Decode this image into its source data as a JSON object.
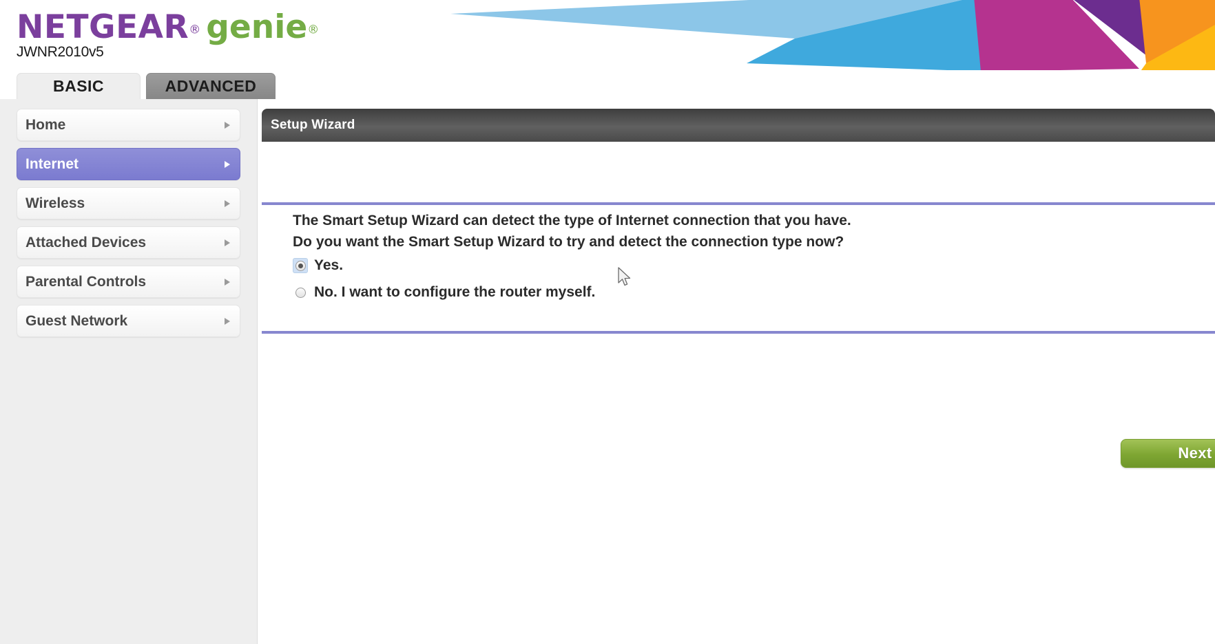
{
  "header": {
    "brand_netgear": "NETGEAR",
    "brand_registered": "®",
    "brand_genie": "genie",
    "brand_genie_registered": "®",
    "model": "JWNR2010v5",
    "brand_purple": "#7b3f9d",
    "brand_green": "#74ac45",
    "art_colors": [
      "#8cc6e8",
      "#3fa9dd",
      "#b5338f",
      "#6c2d8f",
      "#f7941e",
      "#fdb813"
    ]
  },
  "tabs": [
    {
      "label": "BASIC",
      "active": true
    },
    {
      "label": "ADVANCED",
      "active": false
    }
  ],
  "sidebar": {
    "items": [
      {
        "label": "Home",
        "selected": false
      },
      {
        "label": "Internet",
        "selected": true
      },
      {
        "label": "Wireless",
        "selected": false
      },
      {
        "label": "Attached Devices",
        "selected": false
      },
      {
        "label": "Parental Controls",
        "selected": false
      },
      {
        "label": "Guest Network",
        "selected": false
      }
    ],
    "selected_color": "#7b7bd0"
  },
  "content": {
    "panel_title": "Setup Wizard",
    "rule_color": "#8787cf",
    "body_line_1": "The Smart Setup Wizard can detect the type of Internet connection that you have.",
    "body_line_2": "Do you want the Smart Setup Wizard to try and detect the connection type now?",
    "options": [
      {
        "label": "Yes.",
        "selected": true
      },
      {
        "label": "No. I want to configure the router myself.",
        "selected": false
      }
    ],
    "next_label": "Next",
    "next_color": "#7ea632"
  }
}
